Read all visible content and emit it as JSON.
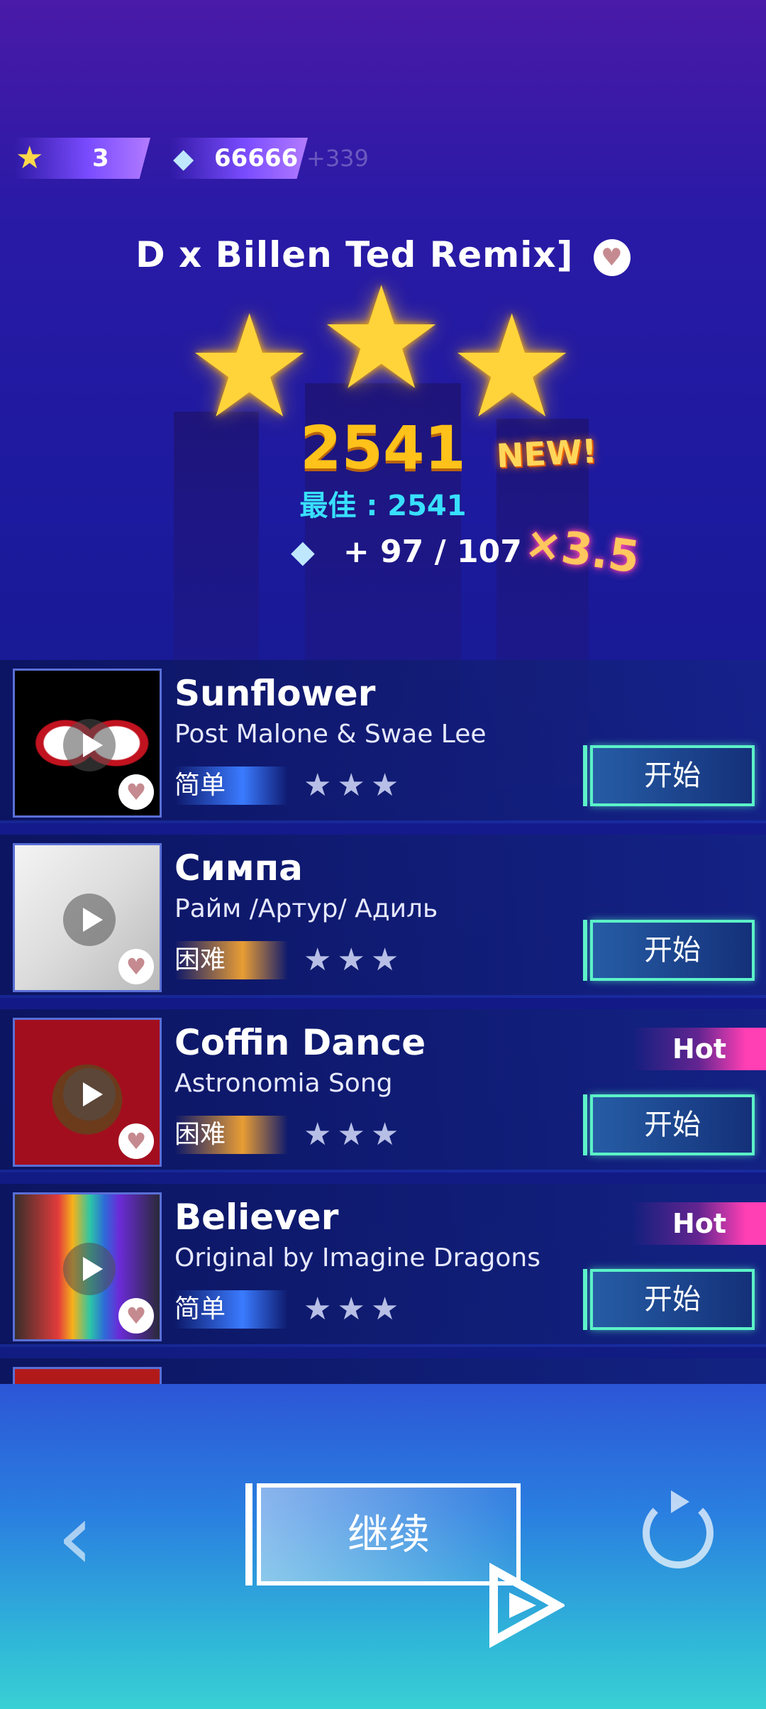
{
  "status": {
    "stars": "3",
    "gems": "66666",
    "gem_bonus": "+339"
  },
  "result": {
    "song_title": "D x Billen Ted Remix]",
    "score": "2541",
    "new_badge": "NEW!",
    "best_label": "最佳 : 2541",
    "reward": "+ 97 / 107",
    "multiplier": "×3.5",
    "stars_earned": 3
  },
  "songs": [
    {
      "title": "Sunflower",
      "artist": "Post Malone & Swae Lee",
      "difficulty": "简单",
      "stars": "★★★",
      "start": "开始",
      "hot": ""
    },
    {
      "title": "Симпа",
      "artist": "Райм /Артур/ Адиль",
      "difficulty": "困难",
      "stars": "★★★",
      "start": "开始",
      "hot": ""
    },
    {
      "title": "Coffin Dance",
      "artist": "Astronomia Song",
      "difficulty": "困难",
      "stars": "★★★",
      "start": "开始",
      "hot": "Hot"
    },
    {
      "title": "Believer",
      "artist": "Original by Imagine Dragons",
      "difficulty": "简单",
      "stars": "★★★",
      "start": "开始",
      "hot": "Hot"
    }
  ],
  "controls": {
    "back_icon": "chevron-left-icon",
    "continue_label": "继续",
    "retry_icon": "retry-icon"
  },
  "colors": {
    "accent_green": "#5cf2c8",
    "score_gold": "#ffc21a",
    "best_cyan": "#38e0ff",
    "hot_pink": "#ff3fb4"
  }
}
